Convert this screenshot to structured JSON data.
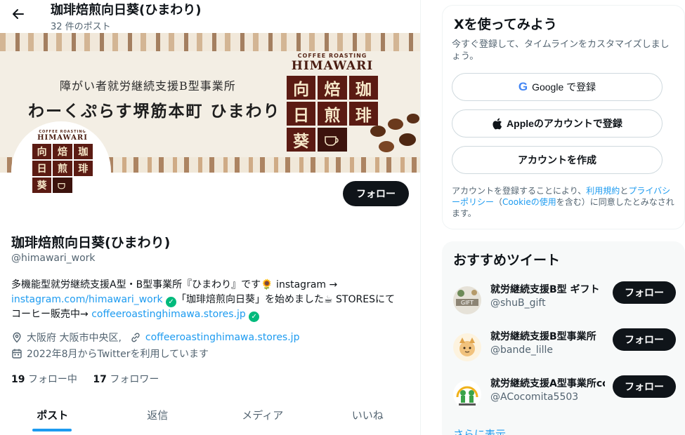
{
  "header": {
    "title": "珈琲焙煎向日葵(ひまわり)",
    "post_count": "32 件のポスト"
  },
  "banner": {
    "line1": "障がい者就労継続支援B型事業所",
    "line2": "わーくぷらす堺筋本町 ひまわり",
    "logo_small": "COFFEE ROASTING",
    "logo_big": "HIMAWARI",
    "logo_chars": [
      "向",
      "焙",
      "珈",
      "日",
      "煎",
      "琲",
      "葵",
      ""
    ]
  },
  "profile": {
    "name": "珈琲焙煎向日葵(ひまわり)",
    "handle": "@himawari_work",
    "follow_label": "フォロー",
    "bio_1": "多機能型就労継続支援A型・B型事業所『ひまわり』です🌻 instagram →",
    "bio_link_1": "instagram.com/himawari_work",
    "bio_2": "「珈琲焙煎向日葵」を始めました☕ STORESにて",
    "bio_3": "コーヒー販売中→",
    "bio_link_2": "coffeeroastinghimawa.stores.jp",
    "location": "大阪府 大阪市中央区,",
    "website": "coffeeroastinghimawa.stores.jp",
    "joined": "2022年8月からTwitterを利用しています",
    "following_count": "19",
    "following_label": "フォロー中",
    "followers_count": "17",
    "followers_label": "フォロワー"
  },
  "tabs": [
    {
      "label": "ポスト"
    },
    {
      "label": "返信"
    },
    {
      "label": "メディア"
    },
    {
      "label": "いいね"
    }
  ],
  "signup": {
    "title": "Xを使ってみよう",
    "desc": "今すぐ登録して、タイムラインをカスタマイズしましょう。",
    "google_label": "Google で登録",
    "apple_label": "Appleのアカウントで登録",
    "create_label": "アカウントを作成",
    "terms_1": "アカウントを登録することにより、",
    "terms_link_1": "利用規約",
    "terms_2": "と",
    "terms_link_2": "プライバシーポリシー",
    "terms_3": "（",
    "terms_link_3": "Cookieの使用",
    "terms_4": "を含む）に同意したとみなされます。"
  },
  "recommended": {
    "title": "おすすめツイート",
    "follow_label": "フォロー",
    "items": [
      {
        "name": "就労継続支援B型 ギフト",
        "handle": "@shuB_gift"
      },
      {
        "name": "就労継続支援B型事業所",
        "handle": "@bande_lille"
      },
      {
        "name": "就労継続支援A型事業所co",
        "handle": "@ACocomita5503"
      }
    ],
    "show_more": "さらに表示"
  },
  "colors": {
    "accent": "#1d9bf0",
    "verified": "#00ba7c",
    "dark_button": "#0f1419",
    "logo_brown": "#5b1b13"
  }
}
